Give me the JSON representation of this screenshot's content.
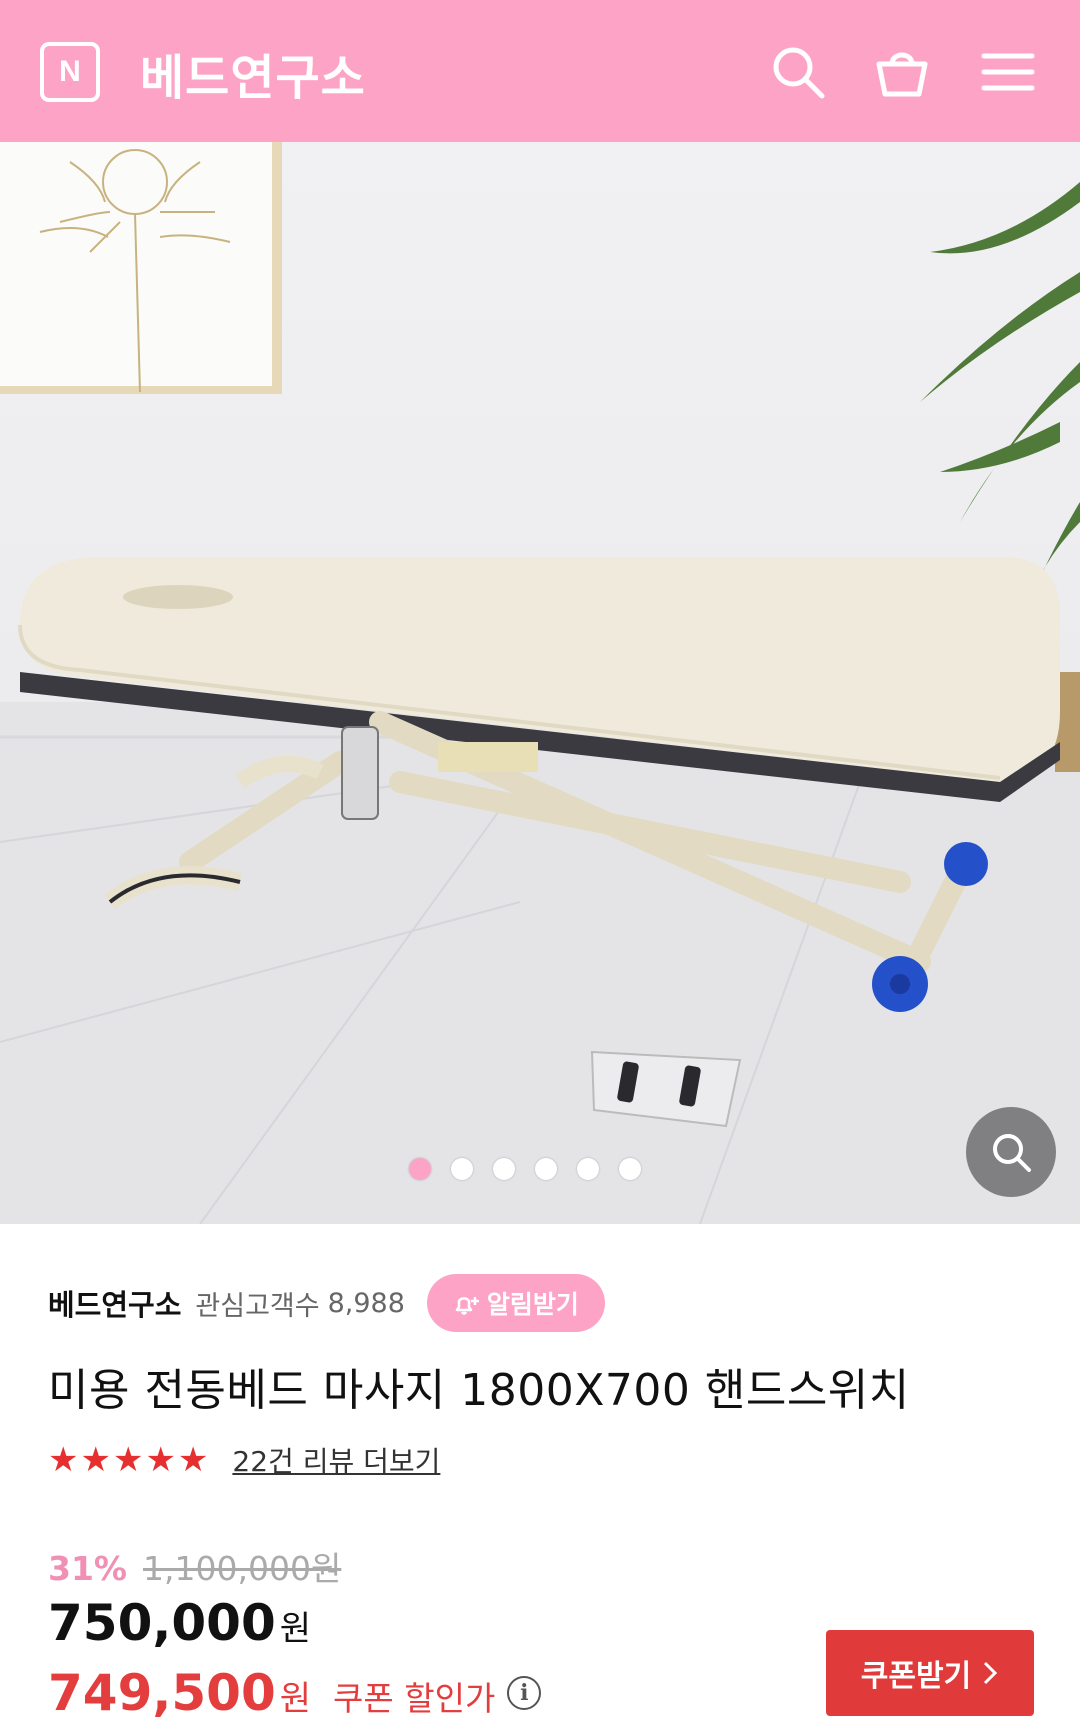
{
  "header": {
    "logo_letter": "N",
    "title": "베드연구소",
    "icons": [
      "search-icon",
      "cart-icon",
      "menu-icon"
    ],
    "bg_color": "#fda4c6"
  },
  "gallery": {
    "slide_count": 6,
    "active_index": 0
  },
  "store": {
    "name": "베드연구소",
    "fav_label": "관심고객수",
    "fav_count": "8,988",
    "alarm_label": "알림받기"
  },
  "product": {
    "title": "미용 전동베드 마사지 1800X700 핸드스위치",
    "rating_stars": 5,
    "stars_text": "★★★★★",
    "review_link": "22건 리뷰 더보기",
    "discount_rate": "31%",
    "original_price": "1,100,000원",
    "price": "750,000",
    "price_unit": "원",
    "coupon_price": "749,500",
    "coupon_price_unit": "원",
    "coupon_label": "쿠폰 할인가",
    "coupon_button": "쿠폰받기"
  },
  "colors": {
    "accent_pink": "#fda4c6",
    "sale_red": "#e33d3d",
    "star_red": "#e63030"
  }
}
